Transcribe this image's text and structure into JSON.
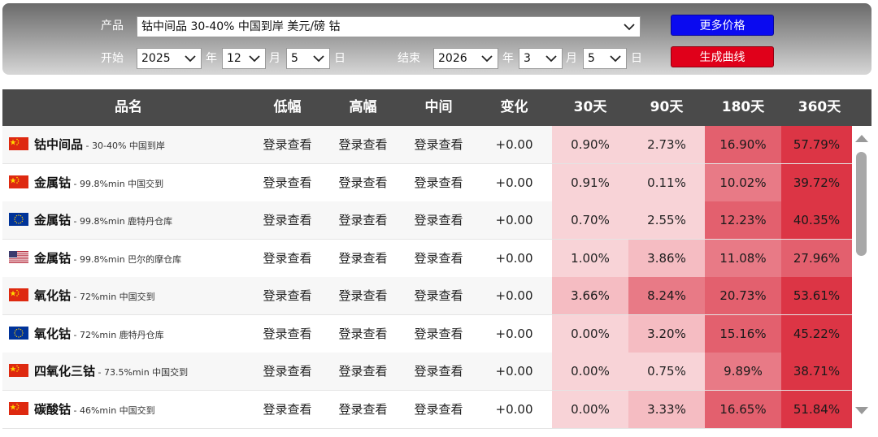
{
  "controls": {
    "product_label": "产品",
    "product_value": "钴中间品 30-40% 中国到岸 美元/磅 钴",
    "start_label": "开始",
    "end_label": "结束",
    "year_unit": "年",
    "month_unit": "月",
    "day_unit": "日",
    "start": {
      "year": "2025",
      "month": "12",
      "day": "5"
    },
    "end": {
      "year": "2026",
      "month": "3",
      "day": "5"
    },
    "more_prices_label": "更多价格",
    "generate_curve_label": "生成曲线",
    "more_prices_color": "#0a0af0",
    "generate_curve_color": "#e0001a"
  },
  "table": {
    "headers": [
      "品名",
      "低幅",
      "高幅",
      "中间",
      "变化",
      "30天",
      "90天",
      "180天",
      "360天"
    ],
    "rows": [
      {
        "flag": "cn",
        "name": "钴中间品",
        "spec": " - 30-40% 中国到岸",
        "low": "登录查看",
        "high": "登录查看",
        "mid": "登录查看",
        "change": "+0.00",
        "d30": "0.90%",
        "d90": "2.73%",
        "d180": "16.90%",
        "d360": "57.79%"
      },
      {
        "flag": "cn",
        "name": "金属钴",
        "spec": " - 99.8%min 中国交到",
        "low": "登录查看",
        "high": "登录查看",
        "mid": "登录查看",
        "change": "+0.00",
        "d30": "0.91%",
        "d90": "0.11%",
        "d180": "10.02%",
        "d360": "39.72%"
      },
      {
        "flag": "eu",
        "name": "金属钴",
        "spec": " - 99.8%min 鹿特丹仓库",
        "low": "登录查看",
        "high": "登录查看",
        "mid": "登录查看",
        "change": "+0.00",
        "d30": "0.70%",
        "d90": "2.55%",
        "d180": "12.23%",
        "d360": "40.35%"
      },
      {
        "flag": "us",
        "name": "金属钴",
        "spec": " - 99.8%min 巴尔的摩仓库",
        "low": "登录查看",
        "high": "登录查看",
        "mid": "登录查看",
        "change": "+0.00",
        "d30": "1.00%",
        "d90": "3.86%",
        "d180": "11.08%",
        "d360": "27.96%"
      },
      {
        "flag": "cn",
        "name": "氧化钴",
        "spec": " - 72%min 中国交到",
        "low": "登录查看",
        "high": "登录查看",
        "mid": "登录查看",
        "change": "+0.00",
        "d30": "3.66%",
        "d90": "8.24%",
        "d180": "20.73%",
        "d360": "53.61%"
      },
      {
        "flag": "eu",
        "name": "氧化钴",
        "spec": " - 72%min 鹿特丹仓库",
        "low": "登录查看",
        "high": "登录查看",
        "mid": "登录查看",
        "change": "+0.00",
        "d30": "0.00%",
        "d90": "3.20%",
        "d180": "15.16%",
        "d360": "45.22%"
      },
      {
        "flag": "cn",
        "name": "四氧化三钴",
        "spec": " - 73.5%min 中国交到",
        "low": "登录查看",
        "high": "登录查看",
        "mid": "登录查看",
        "change": "+0.00",
        "d30": "0.00%",
        "d90": "0.75%",
        "d180": "9.89%",
        "d360": "38.71%"
      },
      {
        "flag": "cn",
        "name": "碳酸钴",
        "spec": " - 46%min 中国交到",
        "low": "登录查看",
        "high": "登录查看",
        "mid": "登录查看",
        "change": "+0.00",
        "d30": "0.00%",
        "d90": "3.33%",
        "d180": "16.65%",
        "d360": "51.84%"
      }
    ]
  },
  "icons": {
    "dropdown": "chevron-down-icon",
    "scroll_up": "triangle-up-icon",
    "scroll_down": "triangle-down-icon"
  }
}
